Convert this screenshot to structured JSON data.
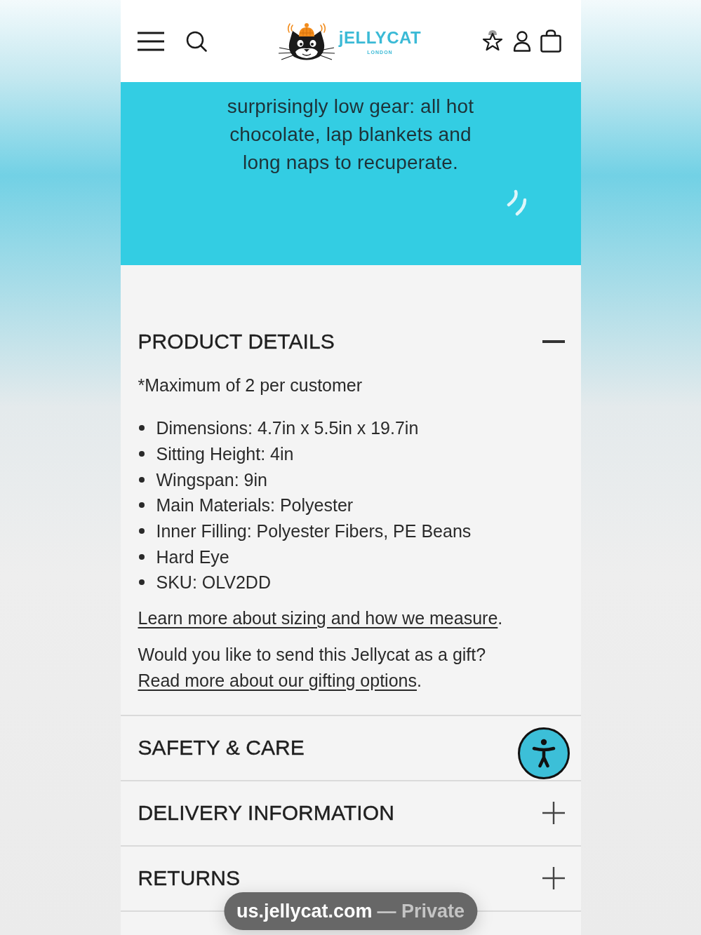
{
  "header": {
    "brand": "jELLYCAT",
    "brand_subtitle": "LONDON"
  },
  "story": {
    "text": "surprisingly low gear: all hot chocolate, lap blankets and long naps to recuperate."
  },
  "sections": [
    {
      "title": "PRODUCT DETAILS",
      "expanded": true,
      "note": "*Maximum of 2 per customer",
      "bullets": [
        "Dimensions: 4.7in x 5.5in x 19.7in",
        "Sitting Height: 4in",
        "Wingspan: 9in",
        "Main Materials: Polyester",
        "Inner Filling: Polyester Fibers, PE Beans",
        "Hard Eye",
        "SKU: OLV2DD"
      ],
      "sizing": {
        "link": "Learn more about sizing and how we measure",
        "after": "."
      },
      "gift": {
        "text": "Would you like to send this Jellycat as a gift?",
        "link": "Read more about our gifting options",
        "after": "."
      }
    },
    {
      "title": "SAFETY & CARE"
    },
    {
      "title": "DELIVERY INFORMATION",
      "expanded": false
    },
    {
      "title": "RETURNS",
      "expanded": false
    }
  ],
  "address_bar": {
    "domain": "us.jellycat.com",
    "mode": "— Private"
  }
}
